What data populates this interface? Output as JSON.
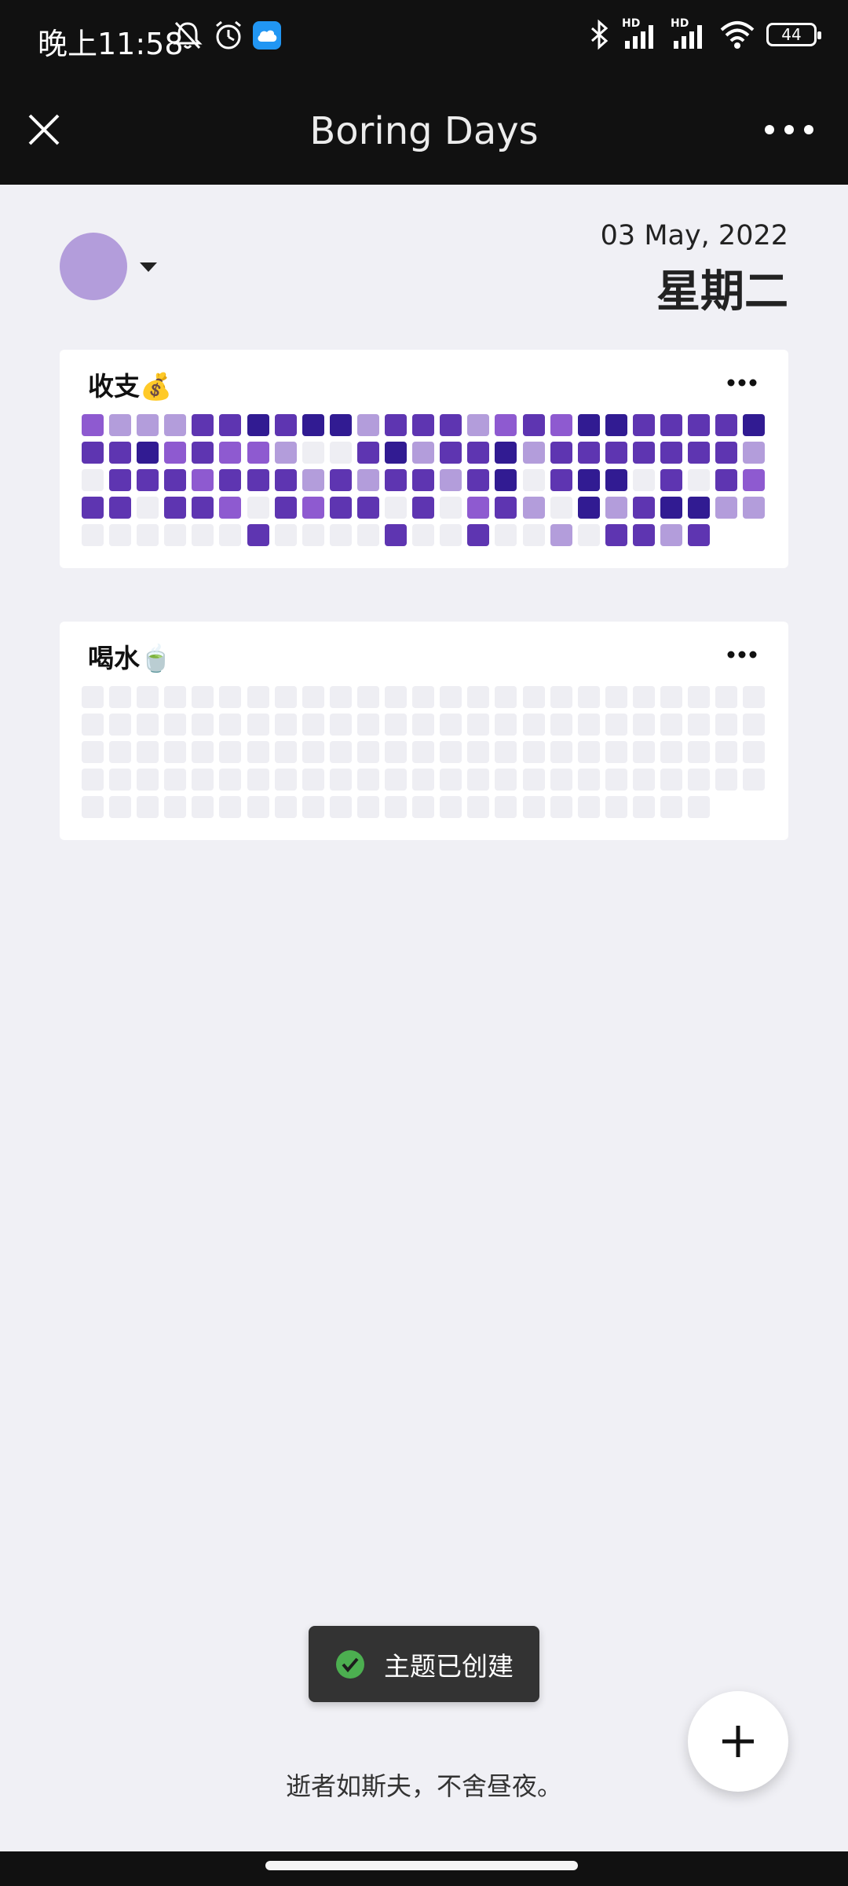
{
  "status_bar": {
    "time": "晚上11:58",
    "battery": "44",
    "network_label_1": "HD",
    "network_label_2": "HD",
    "icons": [
      "mute-icon",
      "alarm-icon",
      "cloud-app-icon",
      "bluetooth-icon",
      "signal-icon",
      "signal-icon",
      "wifi-icon",
      "battery-icon"
    ]
  },
  "app_bar": {
    "title": "Boring Days",
    "close_icon": "close-icon",
    "more_icon": "more-horizontal-icon"
  },
  "header": {
    "avatar_color": "#b39ddb",
    "date": "03 May, 2022",
    "weekday": "星期二"
  },
  "colors": {
    "level0": "#eeeef3",
    "level1": "#b39ddb",
    "level2": "#8e5ad0",
    "level3": "#5e35b1",
    "level4": "#311b92"
  },
  "cards": [
    {
      "title": "收支💰",
      "levels": [
        [
          2,
          1,
          1,
          1,
          3,
          3,
          4,
          3,
          4,
          4,
          1,
          3,
          3,
          3,
          1,
          2,
          3,
          2,
          4,
          4,
          3,
          3,
          3,
          3,
          4
        ],
        [
          3,
          3,
          4,
          2,
          3,
          2,
          2,
          1,
          0,
          0,
          3,
          4,
          1,
          3,
          3,
          4,
          1,
          3,
          3,
          3,
          3,
          3,
          3,
          3,
          1
        ],
        [
          0,
          3,
          3,
          3,
          2,
          3,
          3,
          3,
          1,
          3,
          1,
          3,
          3,
          1,
          3,
          4,
          0,
          3,
          4,
          4,
          0,
          3,
          0,
          3,
          2
        ],
        [
          3,
          3,
          0,
          3,
          3,
          2,
          0,
          3,
          2,
          3,
          3,
          0,
          3,
          0,
          2,
          3,
          1,
          0,
          4,
          1,
          3,
          4,
          4,
          1,
          1
        ],
        [
          0,
          0,
          0,
          0,
          0,
          0,
          3,
          0,
          0,
          0,
          0,
          3,
          0,
          0,
          3,
          0,
          0,
          1,
          0,
          3,
          3,
          1,
          3
        ]
      ]
    },
    {
      "title": "喝水🍵",
      "levels": [
        [
          0,
          0,
          0,
          0,
          0,
          0,
          0,
          0,
          0,
          0,
          0,
          0,
          0,
          0,
          0,
          0,
          0,
          0,
          0,
          0,
          0,
          0,
          0,
          0,
          0
        ],
        [
          0,
          0,
          0,
          0,
          0,
          0,
          0,
          0,
          0,
          0,
          0,
          0,
          0,
          0,
          0,
          0,
          0,
          0,
          0,
          0,
          0,
          0,
          0,
          0,
          0
        ],
        [
          0,
          0,
          0,
          0,
          0,
          0,
          0,
          0,
          0,
          0,
          0,
          0,
          0,
          0,
          0,
          0,
          0,
          0,
          0,
          0,
          0,
          0,
          0,
          0,
          0
        ],
        [
          0,
          0,
          0,
          0,
          0,
          0,
          0,
          0,
          0,
          0,
          0,
          0,
          0,
          0,
          0,
          0,
          0,
          0,
          0,
          0,
          0,
          0,
          0,
          0,
          0
        ],
        [
          0,
          0,
          0,
          0,
          0,
          0,
          0,
          0,
          0,
          0,
          0,
          0,
          0,
          0,
          0,
          0,
          0,
          0,
          0,
          0,
          0,
          0,
          0
        ]
      ]
    }
  ],
  "toast": {
    "icon": "check-circle-icon",
    "text": "主题已创建"
  },
  "fab": {
    "icon": "plus-icon"
  },
  "footer": {
    "quote": "逝者如斯夫，不舍昼夜。"
  }
}
